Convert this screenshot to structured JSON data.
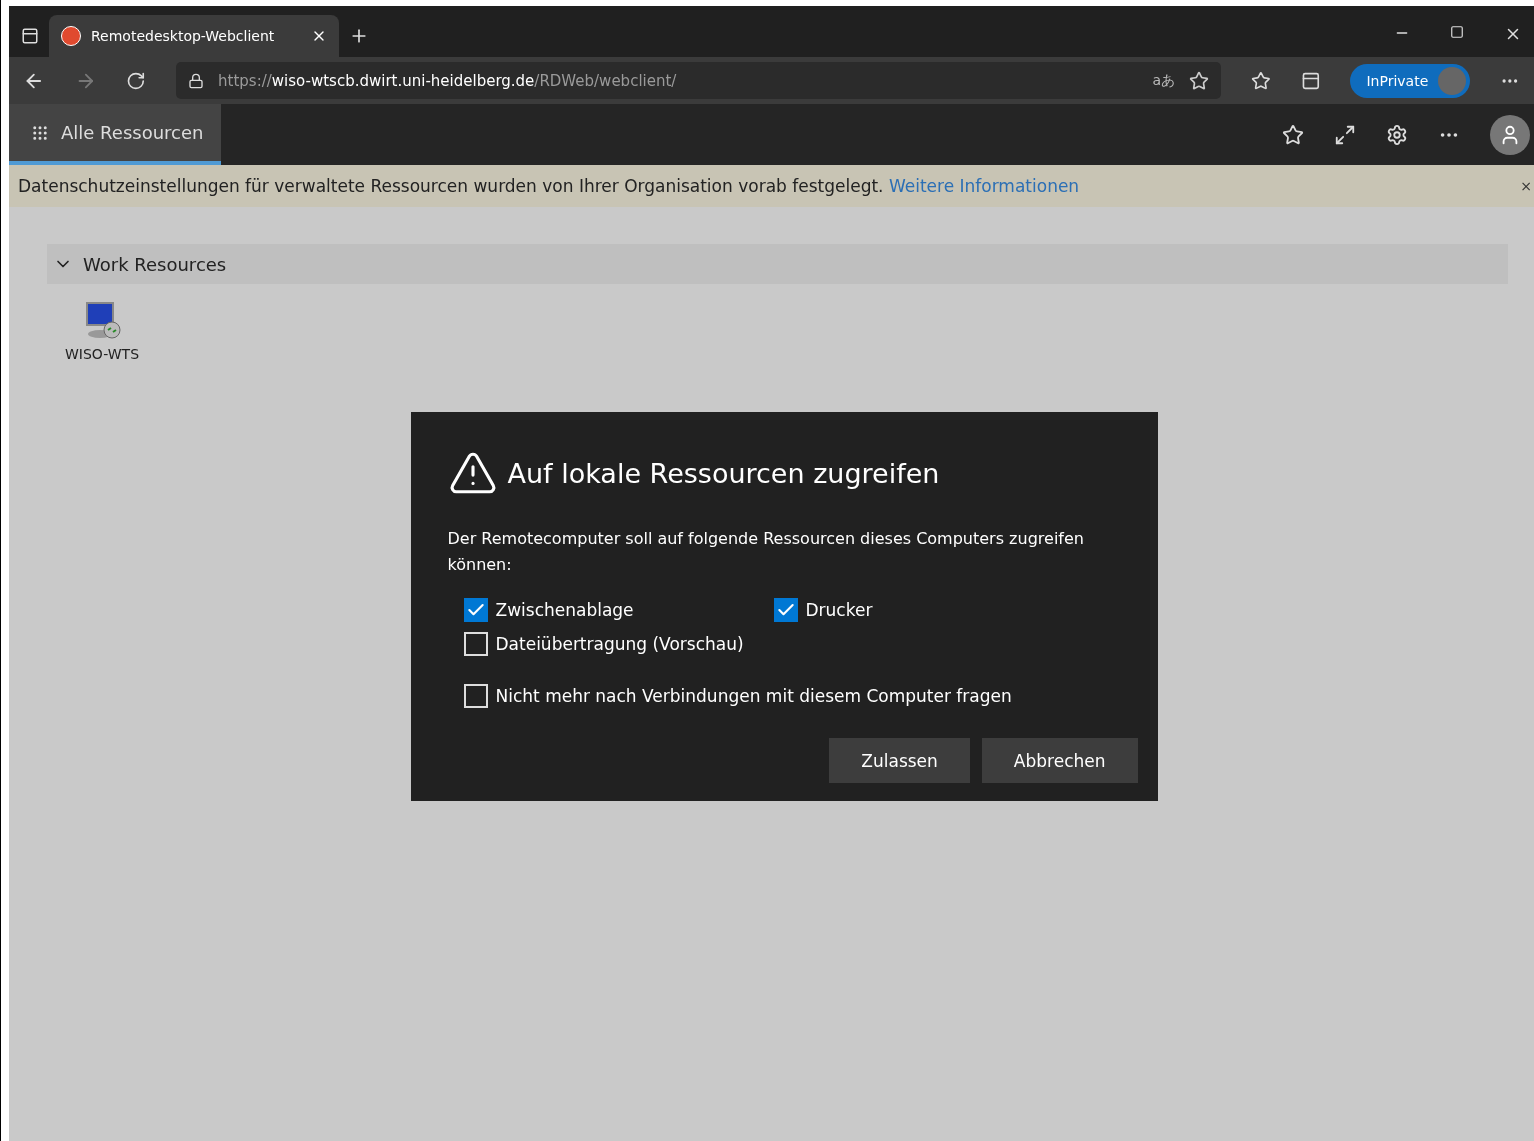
{
  "browser": {
    "tab": {
      "title": "Remotedesktop-Webclient",
      "selected": true
    },
    "address": [
      {
        "text": "https://",
        "kind": "dim"
      },
      {
        "text": "wiso-wtscb.dwirt.uni-heidelberg.de",
        "kind": "host"
      },
      {
        "text": "/RDWeb/webclient/",
        "kind": "dim"
      }
    ],
    "translate": "aあ",
    "inprivate": "InPrivate"
  },
  "app": {
    "nav_tabs": [
      {
        "label": "Alle Ressourcen",
        "selected": true
      }
    ]
  },
  "info_bar": {
    "text": "Datenschutzeinstellungen für verwaltete Ressourcen wurden von Ihrer Organisation vorab festgelegt.",
    "link": "Weitere Informationen",
    "close": "×"
  },
  "group": {
    "title": "Work Resources",
    "expanded": true,
    "items": [
      {
        "label": "WISO-WTS"
      }
    ]
  },
  "dialog": {
    "title": "Auf lokale Ressourcen zugreifen",
    "message": "Der Remotecomputer soll auf folgende Ressourcen dieses Computers zugreifen können:",
    "resources": [
      {
        "label": "Zwischenablage",
        "checked": true
      },
      {
        "label": "Drucker",
        "checked": true
      },
      {
        "label": "Dateiübertragung (Vorschau)",
        "checked": false
      }
    ],
    "dont_ask": {
      "label": "Nicht mehr nach Verbindungen mit diesem Computer fragen",
      "checked": false
    },
    "buttons": [
      {
        "label": "Zulassen"
      },
      {
        "label": "Abbrechen"
      }
    ]
  }
}
